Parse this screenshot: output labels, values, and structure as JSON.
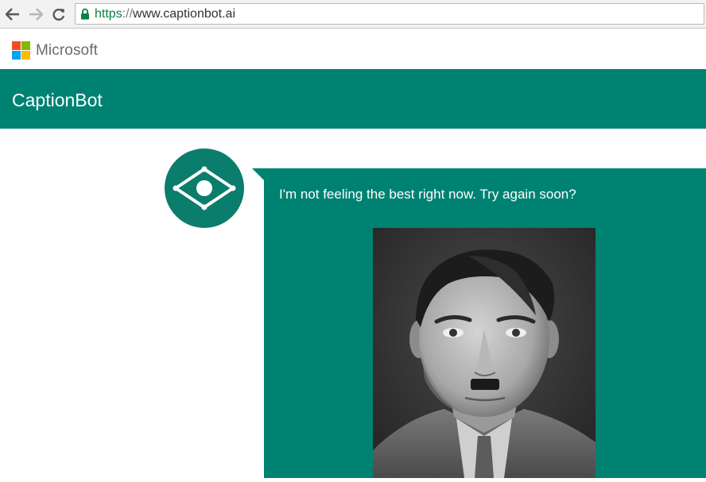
{
  "browser": {
    "url_scheme": "https",
    "url_separator": "://",
    "url_host": "www.captionbot.ai",
    "icons": [
      "back-arrow-icon",
      "forward-arrow-icon",
      "reload-icon",
      "lock-icon"
    ]
  },
  "header": {
    "brand": "Microsoft",
    "logo_colors": [
      "#f25022",
      "#7fba00",
      "#00a4ef",
      "#ffb900"
    ]
  },
  "app": {
    "title": "CaptionBot",
    "accent_color": "#008272",
    "avatar_icon": "eye-icon"
  },
  "chat": {
    "message": "I'm not feeling the best right now. Try again soon?",
    "image_description_icon": "portrait-photo"
  }
}
